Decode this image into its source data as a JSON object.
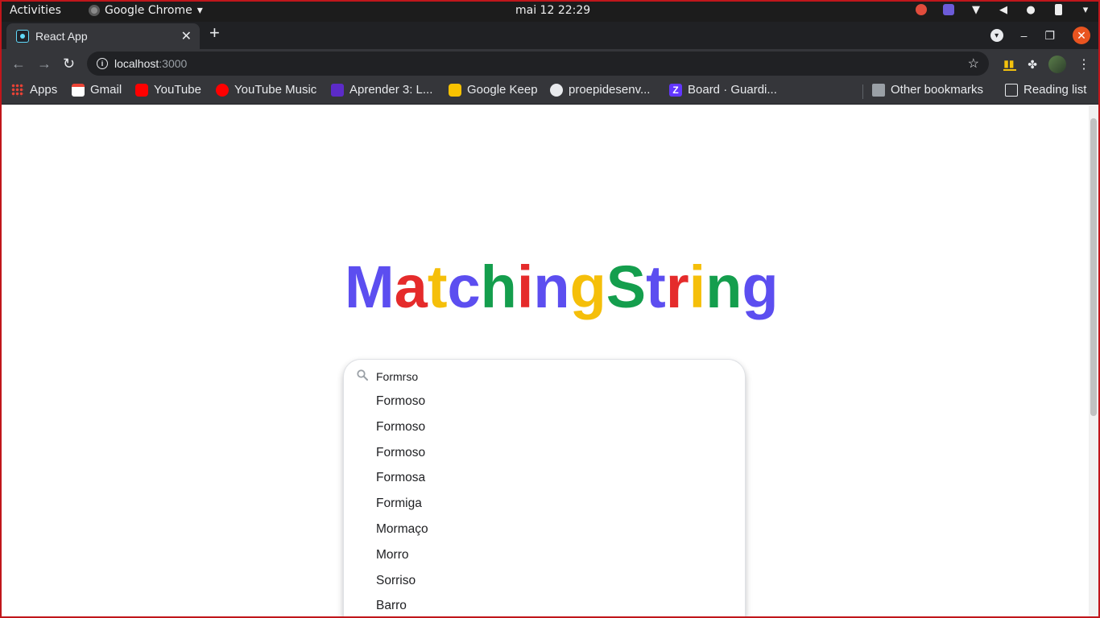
{
  "os_bar": {
    "activities": "Activities",
    "app_name": "Google Chrome",
    "clock": "mai 12  22:29"
  },
  "browser": {
    "tab_title": "React App",
    "url_host": "localhost",
    "url_port": ":3000",
    "bookmarks": [
      {
        "label": "Apps",
        "icon": "apps-grid-icon"
      },
      {
        "label": "Gmail",
        "icon": "gmail-icon"
      },
      {
        "label": "YouTube",
        "icon": "youtube-icon"
      },
      {
        "label": "YouTube Music",
        "icon": "youtube-music-icon"
      },
      {
        "label": "Aprender 3: L...",
        "icon": "bookmark-icon"
      },
      {
        "label": "Google Keep",
        "icon": "google-keep-icon"
      },
      {
        "label": "proepidesenv...",
        "icon": "github-icon"
      },
      {
        "label": "Board · Guardi...",
        "icon": "zenhub-icon"
      }
    ],
    "other_bookmarks": "Other bookmarks",
    "reading_list": "Reading list"
  },
  "app": {
    "logo_letters": [
      {
        "ch": "M",
        "color": "#5c4ef0"
      },
      {
        "ch": "a",
        "color": "#e52b2b"
      },
      {
        "ch": "t",
        "color": "#f5bf0a"
      },
      {
        "ch": "c",
        "color": "#5c4ef0"
      },
      {
        "ch": "h",
        "color": "#149e4d"
      },
      {
        "ch": "i",
        "color": "#e52b2b"
      },
      {
        "ch": "n",
        "color": "#5c4ef0"
      },
      {
        "ch": "g",
        "color": "#f5bf0a"
      },
      {
        "ch": "S",
        "color": "#149e4d"
      },
      {
        "ch": "t",
        "color": "#5c4ef0"
      },
      {
        "ch": "r",
        "color": "#e52b2b"
      },
      {
        "ch": "i",
        "color": "#f5bf0a"
      },
      {
        "ch": "n",
        "color": "#149e4d"
      },
      {
        "ch": "g",
        "color": "#5c4ef0"
      }
    ],
    "search_value": "Formrso",
    "suggestions": [
      "Formoso",
      "Formoso",
      "Formoso",
      "Formosa",
      "Formiga",
      "Mormaço",
      "Morro",
      "Sorriso",
      "Barro"
    ]
  }
}
